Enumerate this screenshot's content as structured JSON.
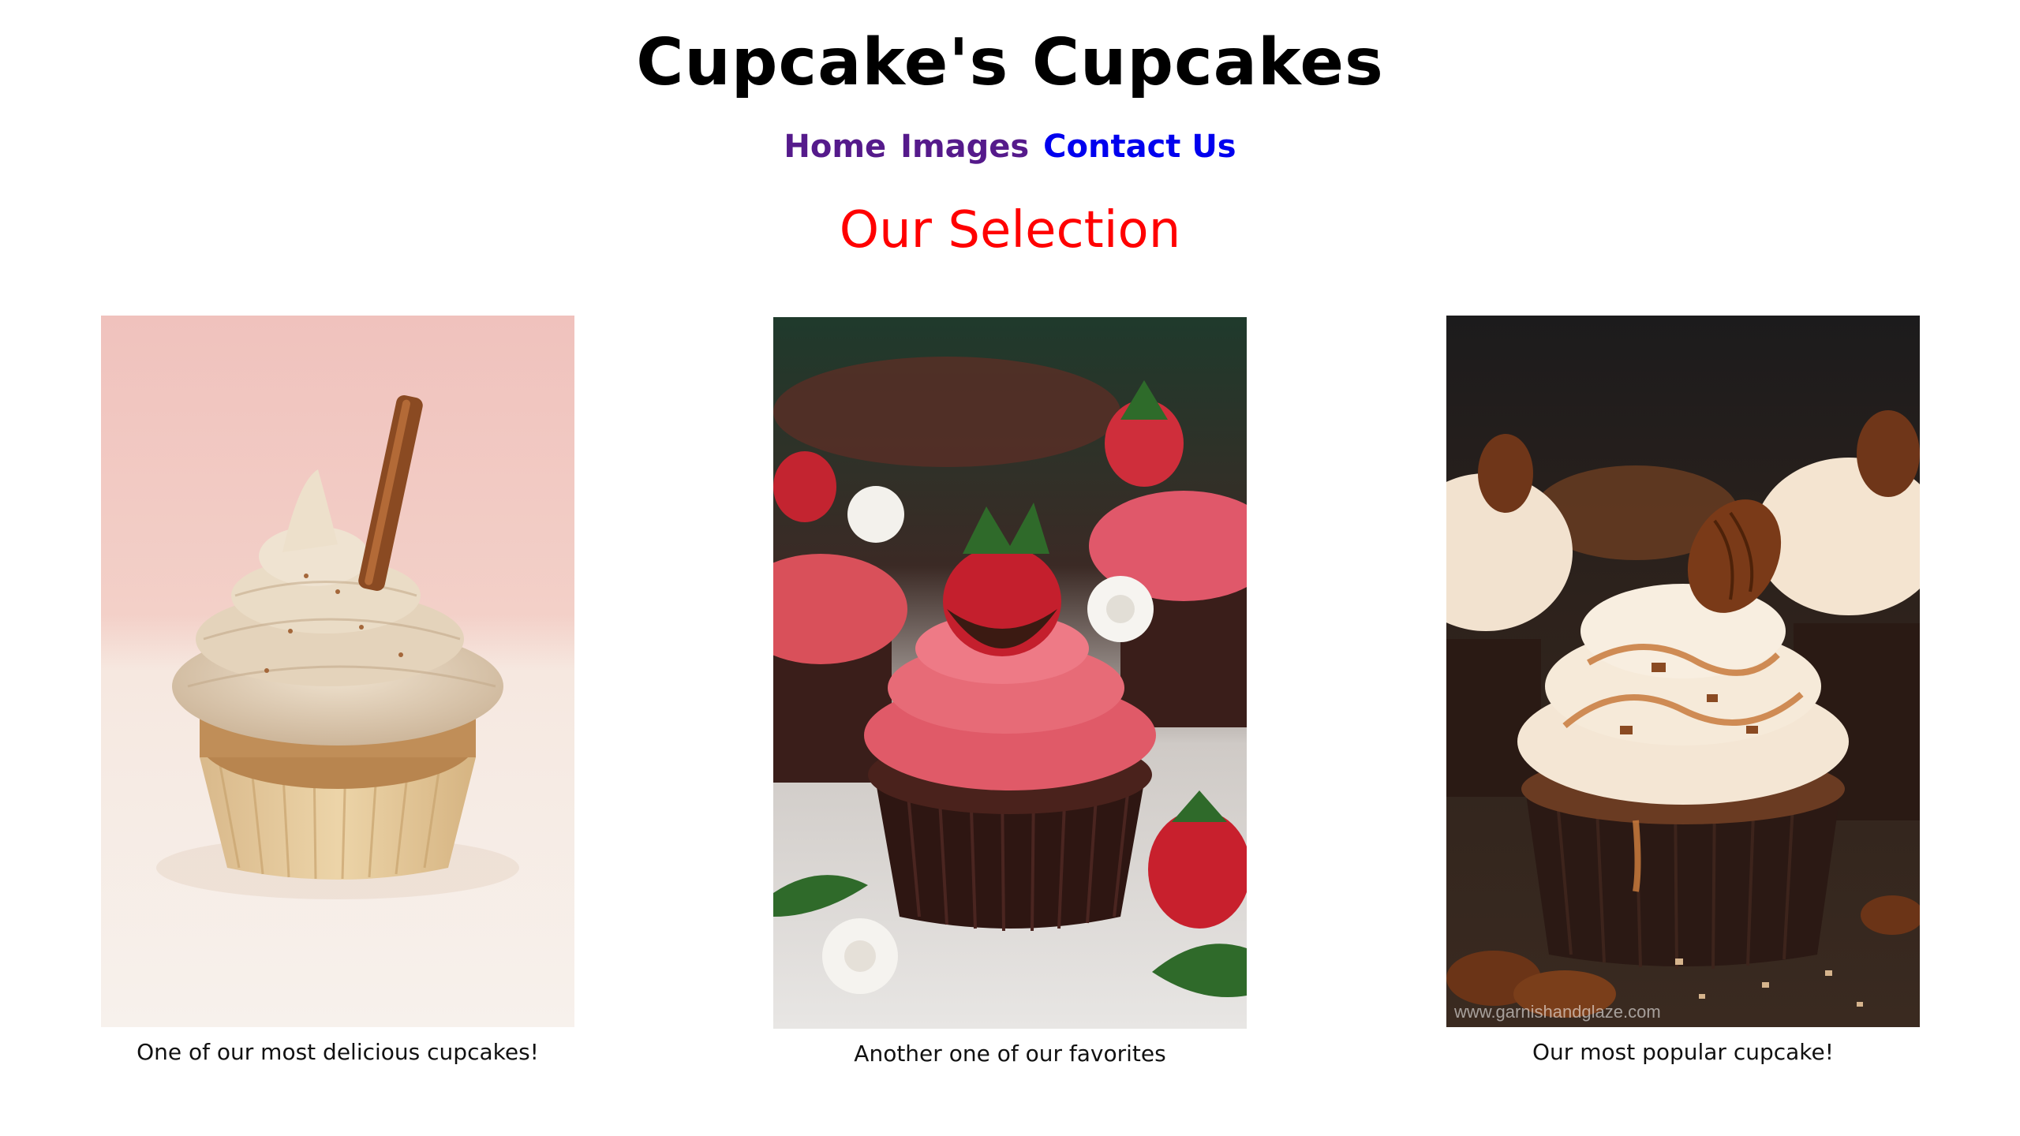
{
  "header": {
    "title": "Cupcake's Cupcakes"
  },
  "nav": {
    "items": [
      {
        "label": "Home",
        "state": "visited"
      },
      {
        "label": "Images",
        "state": "visited"
      },
      {
        "label": "Contact Us",
        "state": "unvisited"
      }
    ]
  },
  "main": {
    "heading": "Our Selection",
    "cards": [
      {
        "image": "cinnamon-cupcake-photo",
        "caption": "One of our most delicious cupcakes!"
      },
      {
        "image": "strawberry-chocolate-cupcake-photo",
        "caption": "Another one of our favorites"
      },
      {
        "image": "pecan-caramel-cupcake-photo",
        "caption": "Our most popular cupcake!",
        "watermark": "www.garnishandglaze.com"
      }
    ]
  },
  "colors": {
    "title": "#000000",
    "heading": "#ff0000",
    "link_visited": "#551a8b",
    "link_unvisited": "#0000ee"
  }
}
